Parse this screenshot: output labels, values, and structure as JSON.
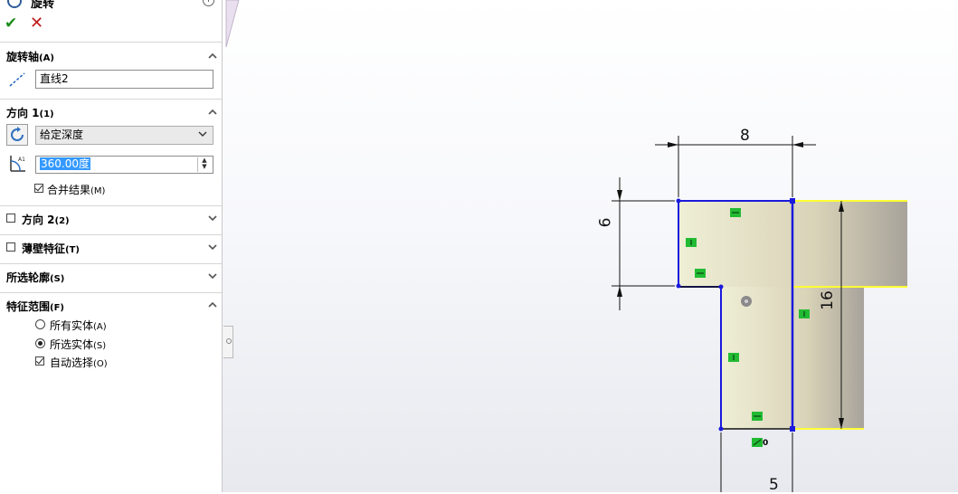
{
  "feature": {
    "title": "旋转"
  },
  "actions": {
    "ok": "✔",
    "cancel": "✕"
  },
  "axis_section": {
    "title": "旋转轴",
    "suffix": "(A)",
    "field_value": "直线2"
  },
  "direction1": {
    "title": "方向 1",
    "suffix": "(1)",
    "type_value": "给定深度",
    "angle_value": "360.00度",
    "merge_label": "合并结果",
    "merge_suffix": "(M)",
    "merge_checked": true
  },
  "direction2": {
    "title": "方向 2",
    "suffix": "(2)",
    "checked": false
  },
  "thin_feature": {
    "title": "薄壁特征",
    "suffix": "(T)",
    "checked": false
  },
  "selected_contours": {
    "title": "所选轮廓",
    "suffix": "(S)"
  },
  "feature_scope": {
    "title": "特征范围",
    "suffix": "(F)",
    "options": [
      {
        "label": "所有实体",
        "suffix": "(A)",
        "selected": false
      },
      {
        "label": "所选实体",
        "suffix": "(S)",
        "selected": true
      }
    ],
    "auto_select_label": "自动选择",
    "auto_select_suffix": "(O)",
    "auto_select_checked": true
  },
  "sketch": {
    "dim_top": "8",
    "dim_left": "6",
    "dim_right": "16",
    "dim_bottom": "5",
    "origin_label": "0"
  },
  "colors": {
    "sketch_line": "#1a1adc",
    "relation": "#22bb33",
    "edge_highlight": "#ffff33"
  }
}
